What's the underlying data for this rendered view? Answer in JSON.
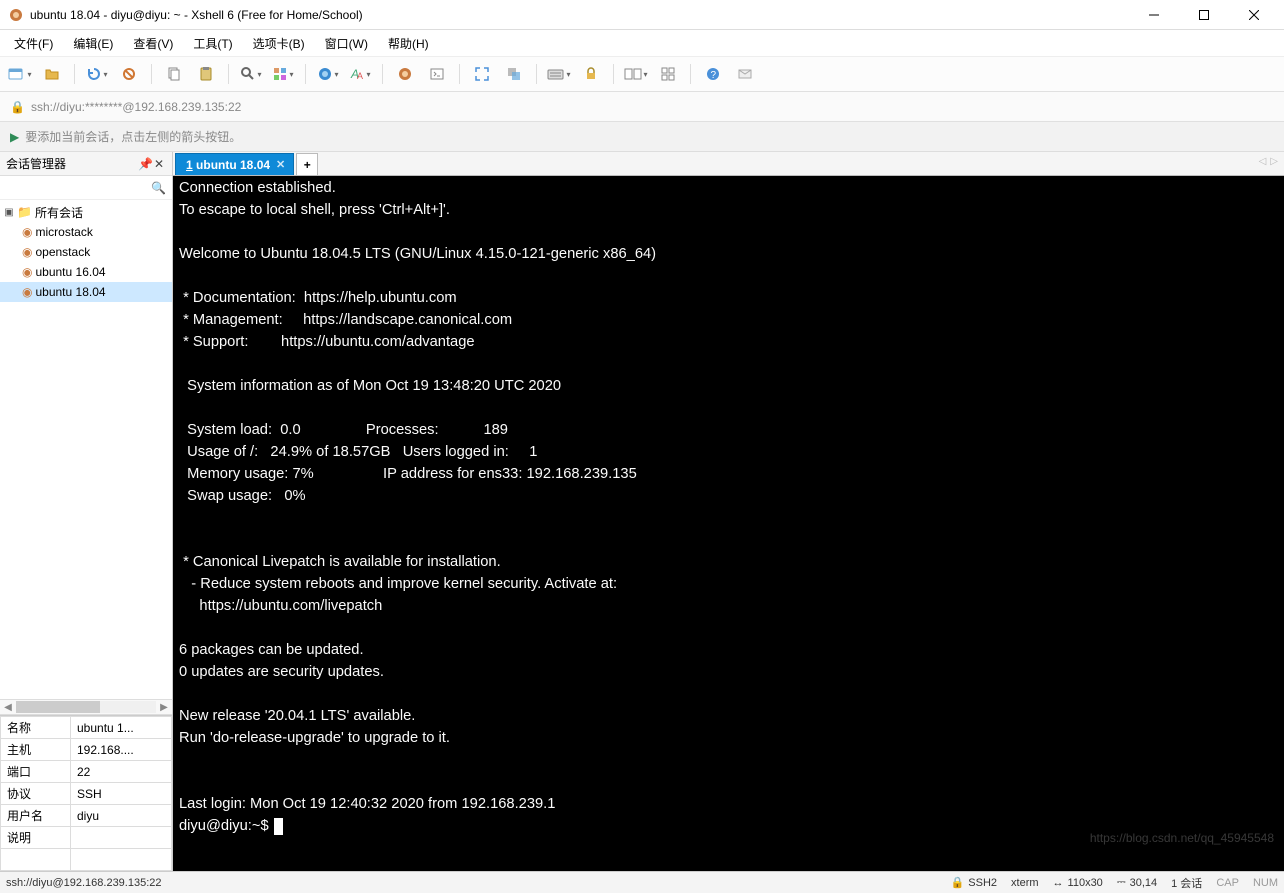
{
  "window": {
    "title": "ubuntu 18.04 - diyu@diyu: ~ - Xshell 6 (Free for Home/School)"
  },
  "menu": {
    "file": "文件(F)",
    "edit": "编辑(E)",
    "view": "查看(V)",
    "tools": "工具(T)",
    "tabs": "选项卡(B)",
    "window": "窗口(W)",
    "help": "帮助(H)"
  },
  "address": {
    "text": "ssh://diyu:********@192.168.239.135:22"
  },
  "hint": {
    "text": "要添加当前会话，点击左侧的箭头按钮。"
  },
  "sidebar": {
    "title": "会话管理器",
    "root": "所有会话",
    "items": [
      {
        "label": "microstack"
      },
      {
        "label": "openstack"
      },
      {
        "label": "ubuntu 16.04"
      },
      {
        "label": "ubuntu 18.04"
      }
    ],
    "props": {
      "name_k": "名称",
      "name_v": "ubuntu 1...",
      "host_k": "主机",
      "host_v": "192.168....",
      "port_k": "端口",
      "port_v": "22",
      "proto_k": "协议",
      "proto_v": "SSH",
      "user_k": "用户名",
      "user_v": "diyu",
      "desc_k": "说明",
      "desc_v": ""
    }
  },
  "tabs": {
    "active_num": "1",
    "active_label": "ubuntu 18.04",
    "add": "+"
  },
  "terminal": {
    "content": "Connection established.\nTo escape to local shell, press 'Ctrl+Alt+]'.\n\nWelcome to Ubuntu 18.04.5 LTS (GNU/Linux 4.15.0-121-generic x86_64)\n\n * Documentation:  https://help.ubuntu.com\n * Management:     https://landscape.canonical.com\n * Support:        https://ubuntu.com/advantage\n\n  System information as of Mon Oct 19 13:48:20 UTC 2020\n\n  System load:  0.0                Processes:           189\n  Usage of /:   24.9% of 18.57GB   Users logged in:     1\n  Memory usage: 7%                 IP address for ens33: 192.168.239.135\n  Swap usage:   0%\n\n\n * Canonical Livepatch is available for installation.\n   - Reduce system reboots and improve kernel security. Activate at:\n     https://ubuntu.com/livepatch\n\n6 packages can be updated.\n0 updates are security updates.\n\nNew release '20.04.1 LTS' available.\nRun 'do-release-upgrade' to upgrade to it.\n\n\nLast login: Mon Oct 19 12:40:32 2020 from 192.168.239.1",
    "prompt": "diyu@diyu:~$ "
  },
  "status": {
    "conn": "ssh://diyu@192.168.239.135:22",
    "proto": "SSH2",
    "term": "xterm",
    "size": "110x30",
    "pos": "30,14",
    "sess": "1 会话",
    "cap": "CAP",
    "num": "NUM"
  },
  "watermark": "https://blog.csdn.net/qq_45945548"
}
